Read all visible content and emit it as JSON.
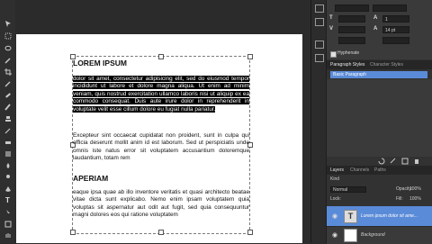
{
  "document": {
    "heading1": "LOREM IPSUM",
    "para1_selected": "dolor sit amet, consectetur adipisicing elit, sed do eiusmod tempor incididunt ut labore et dolore magna aliqua. Ut enim ad minim veniam, quis nostrud exercitation ullamco laboris nisi ut aliquip ex ea commodo consequat. Duis aute irure dolor in reprehenderit in voluptate velit esse cillum dolore eu fugiat nulla pariatur.",
    "para2": "Excepteur sint occaecat cupidatat non proident, sunt in culpa qui officia deserunt mollit anim id est laborum. Sed ut perspiciatis unde omnis iste natus error sit voluptatem accusantium doloremque laudantium, totam rem",
    "heading2": "APERIAM",
    "para3": "eaque ipsa quae ab illo inventore veritatis et quasi architecto beatae vitae dicta sunt explicabo. Nemo enim ipsam voluptatem quia voluptas sit aspernatur aut odit aut fugit, sed quia consequuntur magni dolores eos qui ratione voluptatem"
  },
  "character_panel": {
    "leading": "1",
    "tracking": "14 pt",
    "hyphenate_label": "Hyphenate"
  },
  "paragraph_styles": {
    "tabs": [
      "Paragraph Styles",
      "Character Styles"
    ],
    "basic_item": "Basic Paragraph"
  },
  "layers_panel": {
    "tabs": [
      "Layers",
      "Channels",
      "Paths"
    ],
    "kind_label": "Kind",
    "blend_mode": "Normal",
    "opacity_label": "Opacity:",
    "opacity_value": "100%",
    "lock_label": "Lock:",
    "fill_label": "Fill:",
    "fill_value": "100%",
    "layers": [
      {
        "name": "Lorem ipsum dolor sit ame...",
        "kind": "text",
        "selected": true
      },
      {
        "name": "Background",
        "kind": "raster",
        "selected": false
      }
    ]
  },
  "colors": {
    "selection_highlight": "#000000",
    "layer_selected": "#5a8bd8",
    "panel_bg": "#3a3a3a",
    "workspace_bg": "#2b2b2b"
  }
}
